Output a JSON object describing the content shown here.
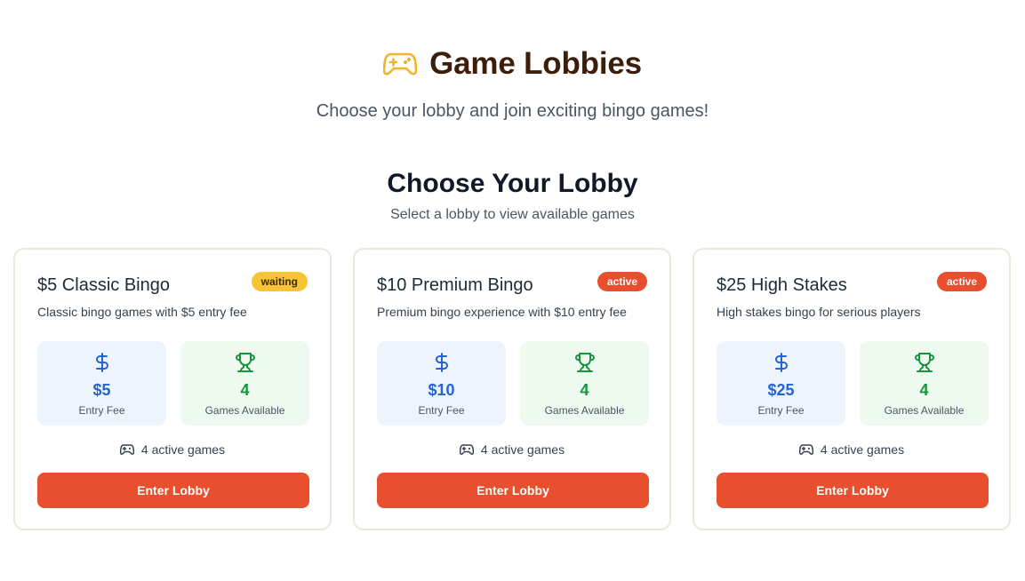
{
  "header": {
    "icon": "gamepad-icon",
    "title": "Game Lobbies",
    "subtitle": "Choose your lobby and join exciting bingo games!"
  },
  "section": {
    "title": "Choose Your Lobby",
    "subtitle": "Select a lobby to view available games"
  },
  "colors": {
    "accent": "#e84f2e",
    "waiting_badge": "#f6c434",
    "fee_text": "#2563d1",
    "games_text": "#18943f"
  },
  "lobbies": [
    {
      "name": "$5 Classic Bingo",
      "status": "waiting",
      "description": "Classic bingo games with $5 entry fee",
      "fee": {
        "icon": "dollar-icon",
        "value": "$5",
        "label": "Entry Fee"
      },
      "games": {
        "icon": "trophy-icon",
        "value": "4",
        "label": "Games Available"
      },
      "active_text": "4 active games",
      "button_label": "Enter Lobby"
    },
    {
      "name": "$10 Premium Bingo",
      "status": "active",
      "description": "Premium bingo experience with $10 entry fee",
      "fee": {
        "icon": "dollar-icon",
        "value": "$10",
        "label": "Entry Fee"
      },
      "games": {
        "icon": "trophy-icon",
        "value": "4",
        "label": "Games Available"
      },
      "active_text": "4 active games",
      "button_label": "Enter Lobby"
    },
    {
      "name": "$25 High Stakes",
      "status": "active",
      "description": "High stakes bingo for serious players",
      "fee": {
        "icon": "dollar-icon",
        "value": "$25",
        "label": "Entry Fee"
      },
      "games": {
        "icon": "trophy-icon",
        "value": "4",
        "label": "Games Available"
      },
      "active_text": "4 active games",
      "button_label": "Enter Lobby"
    }
  ]
}
